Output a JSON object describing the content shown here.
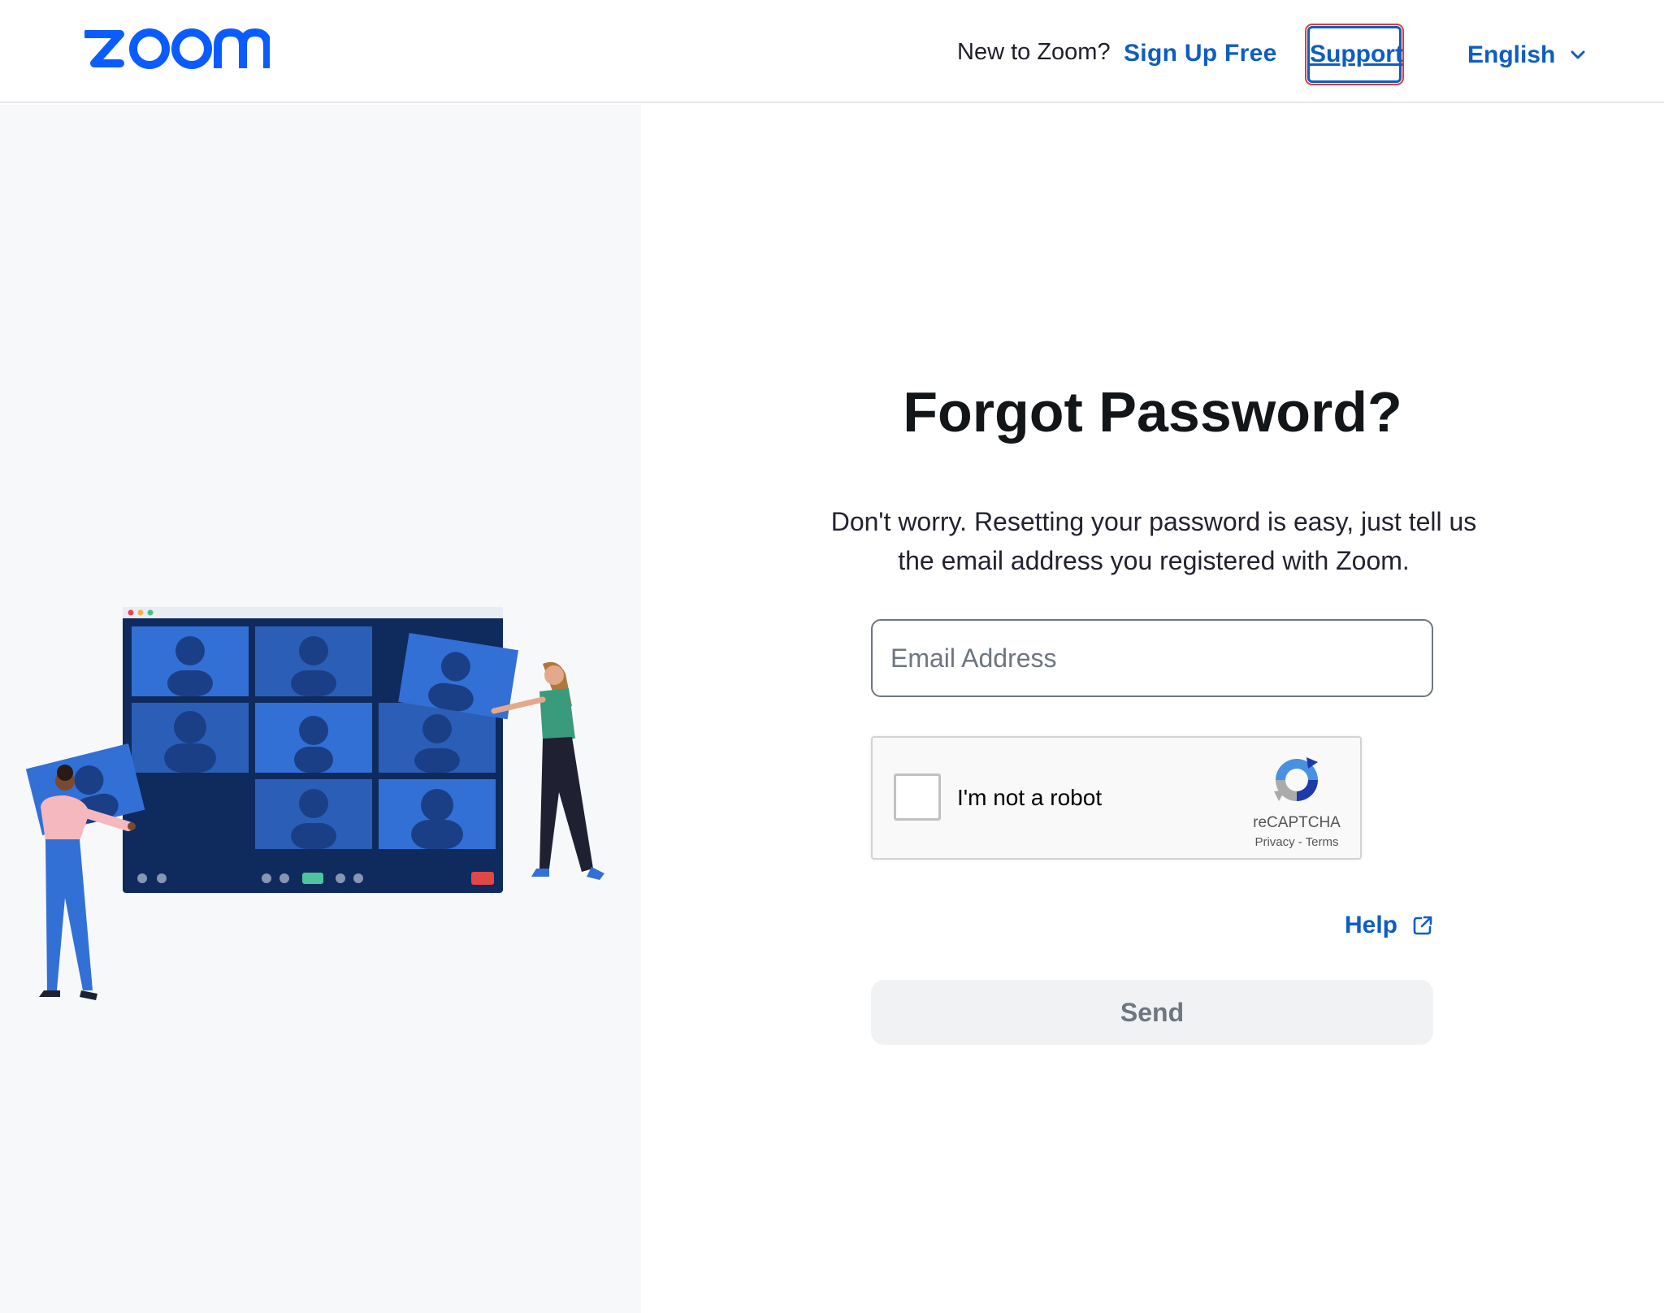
{
  "brand": {
    "logo_text": "zoom",
    "accent_color": "#0B5CFF",
    "link_color": "#0E5DC2"
  },
  "header": {
    "new_prompt": "New to Zoom?",
    "signup_label": "Sign Up Free",
    "support_label": "Support",
    "language_label": "English"
  },
  "form": {
    "title": "Forgot Password?",
    "description": "Don't worry. Resetting your password is easy, just tell us the email address you registered with Zoom.",
    "email_placeholder": "Email Address",
    "email_value": "",
    "help_label": "Help",
    "send_label": "Send"
  },
  "recaptcha": {
    "label": "I'm not a robot",
    "brand": "reCAPTCHA",
    "terms": "Privacy - Terms",
    "checked": false
  },
  "icons": {
    "language_chevron": "chevron-down-icon",
    "help_external": "external-link-icon",
    "recaptcha_logo": "recaptcha-logo-icon"
  }
}
